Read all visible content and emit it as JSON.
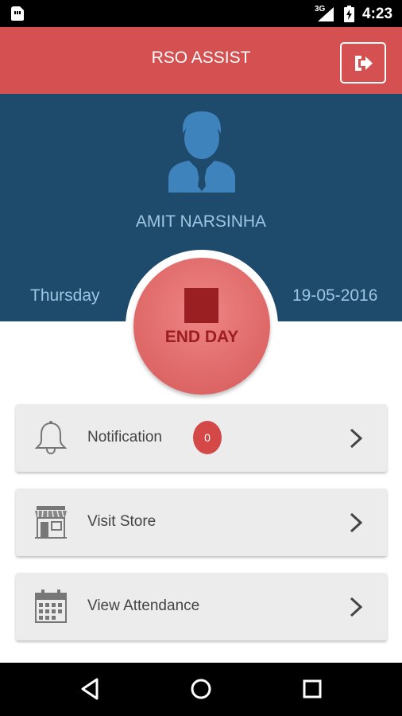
{
  "status_bar": {
    "network_label": "3G",
    "time": "4:23",
    "icons": [
      "sim-card-icon",
      "signal-icon",
      "battery-icon"
    ]
  },
  "app_bar": {
    "title": "RSO ASSIST",
    "logout_icon": "logout-icon"
  },
  "profile": {
    "avatar_icon": "user-avatar-icon",
    "name": "AMIT NARSINHA",
    "day": "Thursday",
    "date": "19-05-2016"
  },
  "end_day_button": {
    "label": "END DAY",
    "icon": "stop-icon"
  },
  "menu": {
    "items": [
      {
        "label": "Notification",
        "icon": "bell-icon",
        "badge": "0"
      },
      {
        "label": "Visit Store",
        "icon": "store-icon"
      },
      {
        "label": "View Attendance",
        "icon": "calendar-icon"
      }
    ]
  },
  "nav_bar": {
    "icons": [
      "back-icon",
      "home-icon",
      "recents-icon"
    ]
  },
  "colors": {
    "app_bar": "#d55050",
    "profile_bg": "#1e4a6b",
    "profile_text": "#9ec6e2",
    "end_day_text": "#9c1d22",
    "card_bg": "#ececec",
    "badge": "#d54848"
  }
}
